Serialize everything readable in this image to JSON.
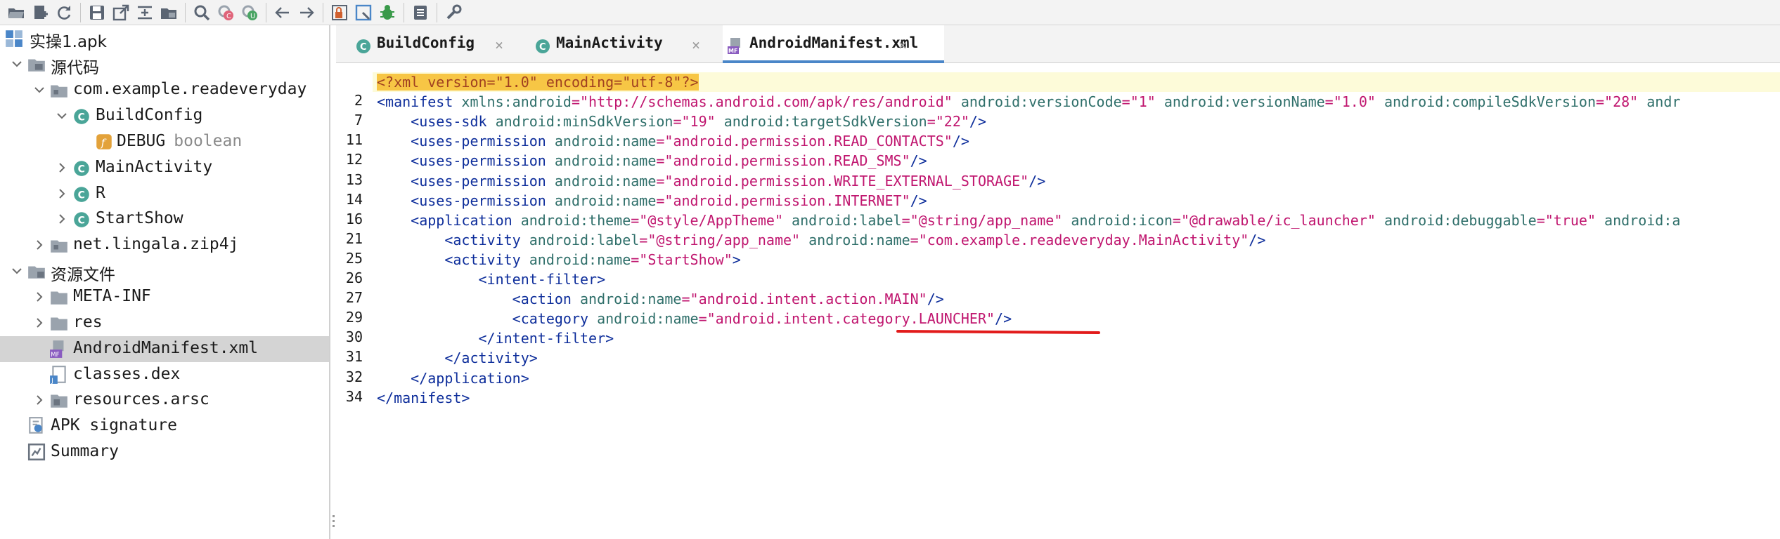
{
  "toolbar": {
    "buttons": [
      {
        "name": "open-file-icon",
        "color": "#5b6573"
      },
      {
        "name": "add-files-icon",
        "color": "#5b6573"
      },
      {
        "name": "reload-icon",
        "color": "#5b6573"
      },
      {
        "name": "save-icon",
        "color": "#5b6573"
      },
      {
        "name": "export-icon",
        "color": "#5b6573"
      },
      {
        "name": "sync-tree-icon",
        "color": "#5b6573"
      },
      {
        "name": "flatten-packages-icon",
        "color": "#5b6573"
      },
      {
        "name": "search-icon",
        "color": "#5b6573"
      },
      {
        "name": "find-class-icon",
        "color": "#e0647a"
      },
      {
        "name": "find-usage-icon",
        "color": "#4aa564"
      },
      {
        "name": "back-icon",
        "color": "#5b6573"
      },
      {
        "name": "forward-icon",
        "color": "#5b6573"
      },
      {
        "name": "deobfuscation-icon",
        "color": "#d0602f"
      },
      {
        "name": "quark-icon",
        "color": "#4a86c8"
      },
      {
        "name": "debug-bug-icon",
        "color": "#3a9a4a"
      },
      {
        "name": "log-icon",
        "color": "#5b6573"
      },
      {
        "name": "preferences-icon",
        "color": "#5b6573"
      }
    ]
  },
  "sidebar": {
    "items": [
      {
        "label": "实操1.apk",
        "extra": "",
        "icon": "apk-project-icon"
      },
      {
        "label": "源代码",
        "extra": "",
        "icon": "source-code-icon"
      },
      {
        "label": "com.example.readeveryday",
        "extra": "",
        "icon": "package-icon"
      },
      {
        "label": "BuildConfig",
        "extra": "",
        "icon": "class-icon"
      },
      {
        "label": "DEBUG",
        "extra": "boolean",
        "icon": "field-icon"
      },
      {
        "label": "MainActivity",
        "extra": "",
        "icon": "class-icon"
      },
      {
        "label": "R",
        "extra": "",
        "icon": "class-icon"
      },
      {
        "label": "StartShow",
        "extra": "",
        "icon": "class-icon"
      },
      {
        "label": "net.lingala.zip4j",
        "extra": "",
        "icon": "package-icon"
      },
      {
        "label": "资源文件",
        "extra": "",
        "icon": "resources-icon"
      },
      {
        "label": "META-INF",
        "extra": "",
        "icon": "folder-icon"
      },
      {
        "label": "res",
        "extra": "",
        "icon": "folder-icon"
      },
      {
        "label": "AndroidManifest.xml",
        "extra": "",
        "icon": "manifest-file-icon"
      },
      {
        "label": "classes.dex",
        "extra": "",
        "icon": "dex-file-icon"
      },
      {
        "label": "resources.arsc",
        "extra": "",
        "icon": "arsc-file-icon"
      },
      {
        "label": "APK signature",
        "extra": "",
        "icon": "certificate-icon"
      },
      {
        "label": "Summary",
        "extra": "",
        "icon": "summary-icon"
      }
    ]
  },
  "tabs": [
    {
      "label": "BuildConfig",
      "icon": "class-icon",
      "close": "×"
    },
    {
      "label": "MainActivity",
      "icon": "class-icon",
      "close": "×"
    },
    {
      "label": "AndroidManifest.xml",
      "icon": "manifest-file-icon",
      "close": "×"
    }
  ],
  "editor": {
    "line_numbers": [
      "",
      "2",
      "7",
      "11",
      "12",
      "13",
      "14",
      "16",
      "21",
      "25",
      "26",
      "27",
      "29",
      "30",
      "31",
      "32",
      "34"
    ],
    "lines": [
      [
        [
          "xmldecl",
          "<?xml version=\"1.0\" encoding=\"utf-8\"?>"
        ]
      ],
      [
        [
          "t",
          "<manifest "
        ],
        [
          "a",
          "xmlns:android"
        ],
        [
          "p",
          "="
        ],
        [
          "v",
          "\"http://schemas.android.com/apk/res/android\""
        ],
        [
          "a",
          " android:versionCode"
        ],
        [
          "p",
          "="
        ],
        [
          "v",
          "\"1\""
        ],
        [
          "a",
          " android:versionName"
        ],
        [
          "p",
          "="
        ],
        [
          "v",
          "\"1.0\""
        ],
        [
          "a",
          " android:compileSdkVersion"
        ],
        [
          "p",
          "="
        ],
        [
          "v",
          "\"28\""
        ],
        [
          "a",
          " andr"
        ]
      ],
      [
        [
          "t",
          "    <uses-sdk "
        ],
        [
          "a",
          "android:minSdkVersion"
        ],
        [
          "p",
          "="
        ],
        [
          "v",
          "\"19\""
        ],
        [
          "a",
          " android:targetSdkVersion"
        ],
        [
          "p",
          "="
        ],
        [
          "v",
          "\"22\""
        ],
        [
          "t",
          "/>"
        ]
      ],
      [
        [
          "t",
          "    <uses-permission "
        ],
        [
          "a",
          "android:name"
        ],
        [
          "p",
          "="
        ],
        [
          "v",
          "\"android.permission.READ_CONTACTS\""
        ],
        [
          "t",
          "/>"
        ]
      ],
      [
        [
          "t",
          "    <uses-permission "
        ],
        [
          "a",
          "android:name"
        ],
        [
          "p",
          "="
        ],
        [
          "v",
          "\"android.permission.READ_SMS\""
        ],
        [
          "t",
          "/>"
        ]
      ],
      [
        [
          "t",
          "    <uses-permission "
        ],
        [
          "a",
          "android:name"
        ],
        [
          "p",
          "="
        ],
        [
          "v",
          "\"android.permission.WRITE_EXTERNAL_STORAGE\""
        ],
        [
          "t",
          "/>"
        ]
      ],
      [
        [
          "t",
          "    <uses-permission "
        ],
        [
          "a",
          "android:name"
        ],
        [
          "p",
          "="
        ],
        [
          "v",
          "\"android.permission.INTERNET\""
        ],
        [
          "t",
          "/>"
        ]
      ],
      [
        [
          "t",
          "    <application "
        ],
        [
          "a",
          "android:theme"
        ],
        [
          "p",
          "="
        ],
        [
          "v",
          "\"@style/AppTheme\""
        ],
        [
          "a",
          " android:label"
        ],
        [
          "p",
          "="
        ],
        [
          "v",
          "\"@string/app_name\""
        ],
        [
          "a",
          " android:icon"
        ],
        [
          "p",
          "="
        ],
        [
          "v",
          "\"@drawable/ic_launcher\""
        ],
        [
          "a",
          " android:debuggable"
        ],
        [
          "p",
          "="
        ],
        [
          "v",
          "\"true\""
        ],
        [
          "a",
          " android:a"
        ]
      ],
      [
        [
          "t",
          "        <activity "
        ],
        [
          "a",
          "android:label"
        ],
        [
          "p",
          "="
        ],
        [
          "v",
          "\"@string/app_name\""
        ],
        [
          "a",
          " android:name"
        ],
        [
          "p",
          "="
        ],
        [
          "v",
          "\"com.example.readeveryday.MainActivity\""
        ],
        [
          "t",
          "/>"
        ]
      ],
      [
        [
          "t",
          "        <activity "
        ],
        [
          "a",
          "android:name"
        ],
        [
          "p",
          "="
        ],
        [
          "v",
          "\"StartShow\""
        ],
        [
          "t",
          ">"
        ]
      ],
      [
        [
          "t",
          "            <intent-filter>"
        ]
      ],
      [
        [
          "t",
          "                <action "
        ],
        [
          "a",
          "android:name"
        ],
        [
          "p",
          "="
        ],
        [
          "v",
          "\"android.intent.action.MAIN\""
        ],
        [
          "t",
          "/>"
        ]
      ],
      [
        [
          "t",
          "                <category "
        ],
        [
          "a",
          "android:name"
        ],
        [
          "p",
          "="
        ],
        [
          "v",
          "\"android.intent.category.LAUNCHER\""
        ],
        [
          "t",
          "/>"
        ]
      ],
      [
        [
          "t",
          "            </intent-filter>"
        ]
      ],
      [
        [
          "t",
          "        </activity>"
        ]
      ],
      [
        [
          "t",
          "    </application>"
        ]
      ],
      [
        [
          "t",
          "</manifest>"
        ]
      ]
    ]
  }
}
